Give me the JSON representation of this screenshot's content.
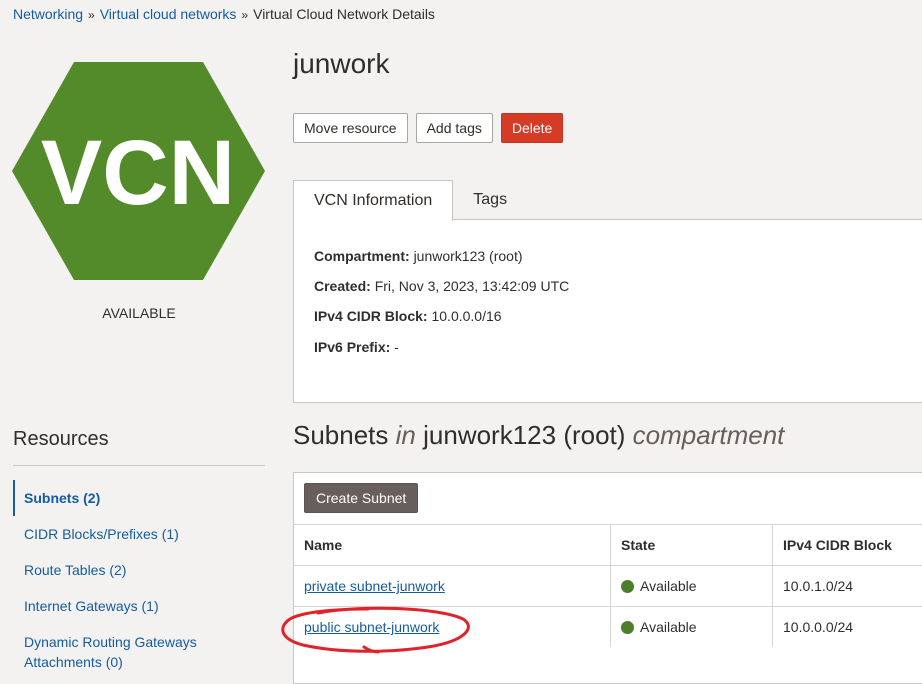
{
  "breadcrumb": {
    "items": [
      {
        "label": "Networking"
      },
      {
        "label": "Virtual cloud networks"
      }
    ],
    "current": "Virtual Cloud Network Details",
    "separator": "»"
  },
  "badge": {
    "text": "VCN",
    "status": "AVAILABLE",
    "color": "#548b2a"
  },
  "header": {
    "title": "junwork",
    "buttons": {
      "move": "Move resource",
      "tags": "Add tags",
      "delete": "Delete"
    }
  },
  "tabs": [
    {
      "label": "VCN Information",
      "active": true
    },
    {
      "label": "Tags",
      "active": false
    }
  ],
  "info": {
    "compartment_label": "Compartment:",
    "compartment_value": "junwork123 (root)",
    "created_label": "Created:",
    "created_value": "Fri, Nov 3, 2023, 13:42:09 UTC",
    "ipv4_label": "IPv4 CIDR Block:",
    "ipv4_value": "10.0.0.0/16",
    "ipv6_label": "IPv6 Prefix:",
    "ipv6_value": "-"
  },
  "resources": {
    "title": "Resources",
    "items": [
      {
        "label": "Subnets (2)",
        "active": true
      },
      {
        "label": "CIDR Blocks/Prefixes (1)"
      },
      {
        "label": "Route Tables (2)"
      },
      {
        "label": "Internet Gateways (1)"
      },
      {
        "label": "Dynamic Routing Gateways Attachments (0)"
      }
    ]
  },
  "subnets": {
    "heading_main": "Subnets",
    "heading_in": "in",
    "heading_compartment": "junwork123 (root)",
    "heading_suffix": "compartment",
    "create_button": "Create Subnet",
    "columns": [
      "Name",
      "State",
      "IPv4 CIDR Block"
    ],
    "rows": [
      {
        "name": "private subnet-junwork",
        "state": "Available",
        "cidr": "10.0.1.0/24"
      },
      {
        "name": "public subnet-junwork",
        "state": "Available",
        "cidr": "10.0.0.0/24"
      }
    ]
  },
  "colors": {
    "link": "#145c9e",
    "danger": "#d63b25",
    "available": "#4e7d2b",
    "annotation": "#e0232b"
  }
}
